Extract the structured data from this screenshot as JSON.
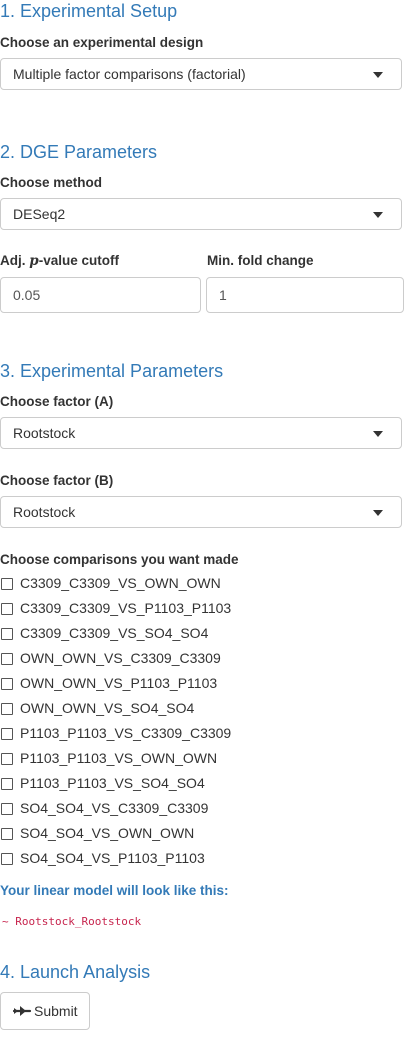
{
  "sections": {
    "setup": "1. Experimental Setup",
    "dge": "2. DGE Parameters",
    "experimental": "3. Experimental Parameters",
    "launch": "4. Launch Analysis"
  },
  "design": {
    "label": "Choose an experimental design",
    "value": "Multiple factor comparisons (factorial)"
  },
  "method": {
    "label": "Choose method",
    "value": "DESeq2"
  },
  "pvalue": {
    "label_prefix": "Adj. ",
    "label_p": "p",
    "label_suffix": "-value cutoff",
    "value": "0.05"
  },
  "foldchange": {
    "label": "Min. fold change",
    "value": "1"
  },
  "factor_a": {
    "label": "Choose factor (A)",
    "value": "Rootstock"
  },
  "factor_b": {
    "label": "Choose factor (B)",
    "value": "Rootstock"
  },
  "comparisons": {
    "label": "Choose comparisons you want made",
    "items": [
      "C3309_C3309_VS_OWN_OWN",
      "C3309_C3309_VS_P1103_P1103",
      "C3309_C3309_VS_SO4_SO4",
      "OWN_OWN_VS_C3309_C3309",
      "OWN_OWN_VS_P1103_P1103",
      "OWN_OWN_VS_SO4_SO4",
      "P1103_P1103_VS_C3309_C3309",
      "P1103_P1103_VS_OWN_OWN",
      "P1103_P1103_VS_SO4_SO4",
      "SO4_SO4_VS_C3309_C3309",
      "SO4_SO4_VS_OWN_OWN",
      "SO4_SO4_VS_P1103_P1103"
    ]
  },
  "model": {
    "note": "Your linear model will look like this:",
    "formula": "~ Rootstock_Rootstock"
  },
  "submit": {
    "label": "Submit",
    "icon": "paper-plane-icon"
  },
  "colors": {
    "accent": "#337ab7",
    "code": "#c7254e"
  }
}
